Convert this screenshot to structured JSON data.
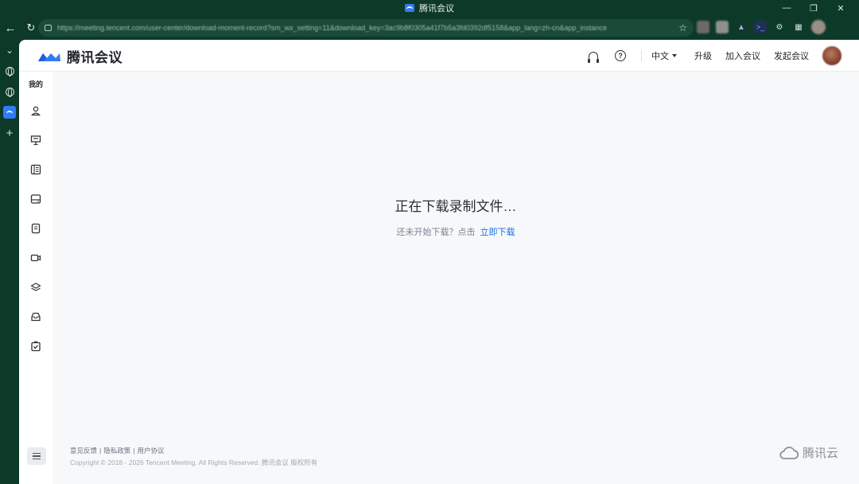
{
  "window": {
    "title": "腾讯会议",
    "controls": [
      "minimize",
      "restore",
      "close"
    ]
  },
  "browser": {
    "url": "https://meeting.tencent.com/user-center/download-moment-record?sm_wx_setting=11&download_key=3ac9b8f0305a41f7b5a3fd0392df5158&app_lang=zh-cn&app_instance",
    "rail_icons": [
      "chevron-down-icon",
      "globe-icon",
      "globe-icon",
      "tencent-meeting-tab-icon",
      "plus-icon"
    ]
  },
  "header": {
    "brand": "腾讯会议",
    "language": "中文",
    "upgrade": "升级",
    "join_meeting": "加入会议",
    "start_meeting": "发起会议"
  },
  "sidebar": {
    "me_label": "我的",
    "items": [
      "profile-icon",
      "presentation-icon",
      "list-icon",
      "drive-icon",
      "document-icon",
      "recording-icon",
      "layers-icon",
      "inbox-icon",
      "task-check-icon"
    ]
  },
  "main": {
    "status_title": "正在下载录制文件…",
    "hint_text": "还未开始下载？点击",
    "hint_link": "立即下载"
  },
  "footer": {
    "feedback": "意见反馈",
    "privacy": "隐私政策",
    "agreement": "用户协议",
    "separator": "|",
    "copyright": "Copyright © 2018 - 2026 Tencent Meeting. All Rights Reserved. 腾讯会议 版权所有",
    "cloud_brand": "腾讯云"
  },
  "colors": {
    "accent": "#1f6fe5",
    "brand_blue": "#2f7cf6",
    "chrome": "#0d3a28"
  }
}
